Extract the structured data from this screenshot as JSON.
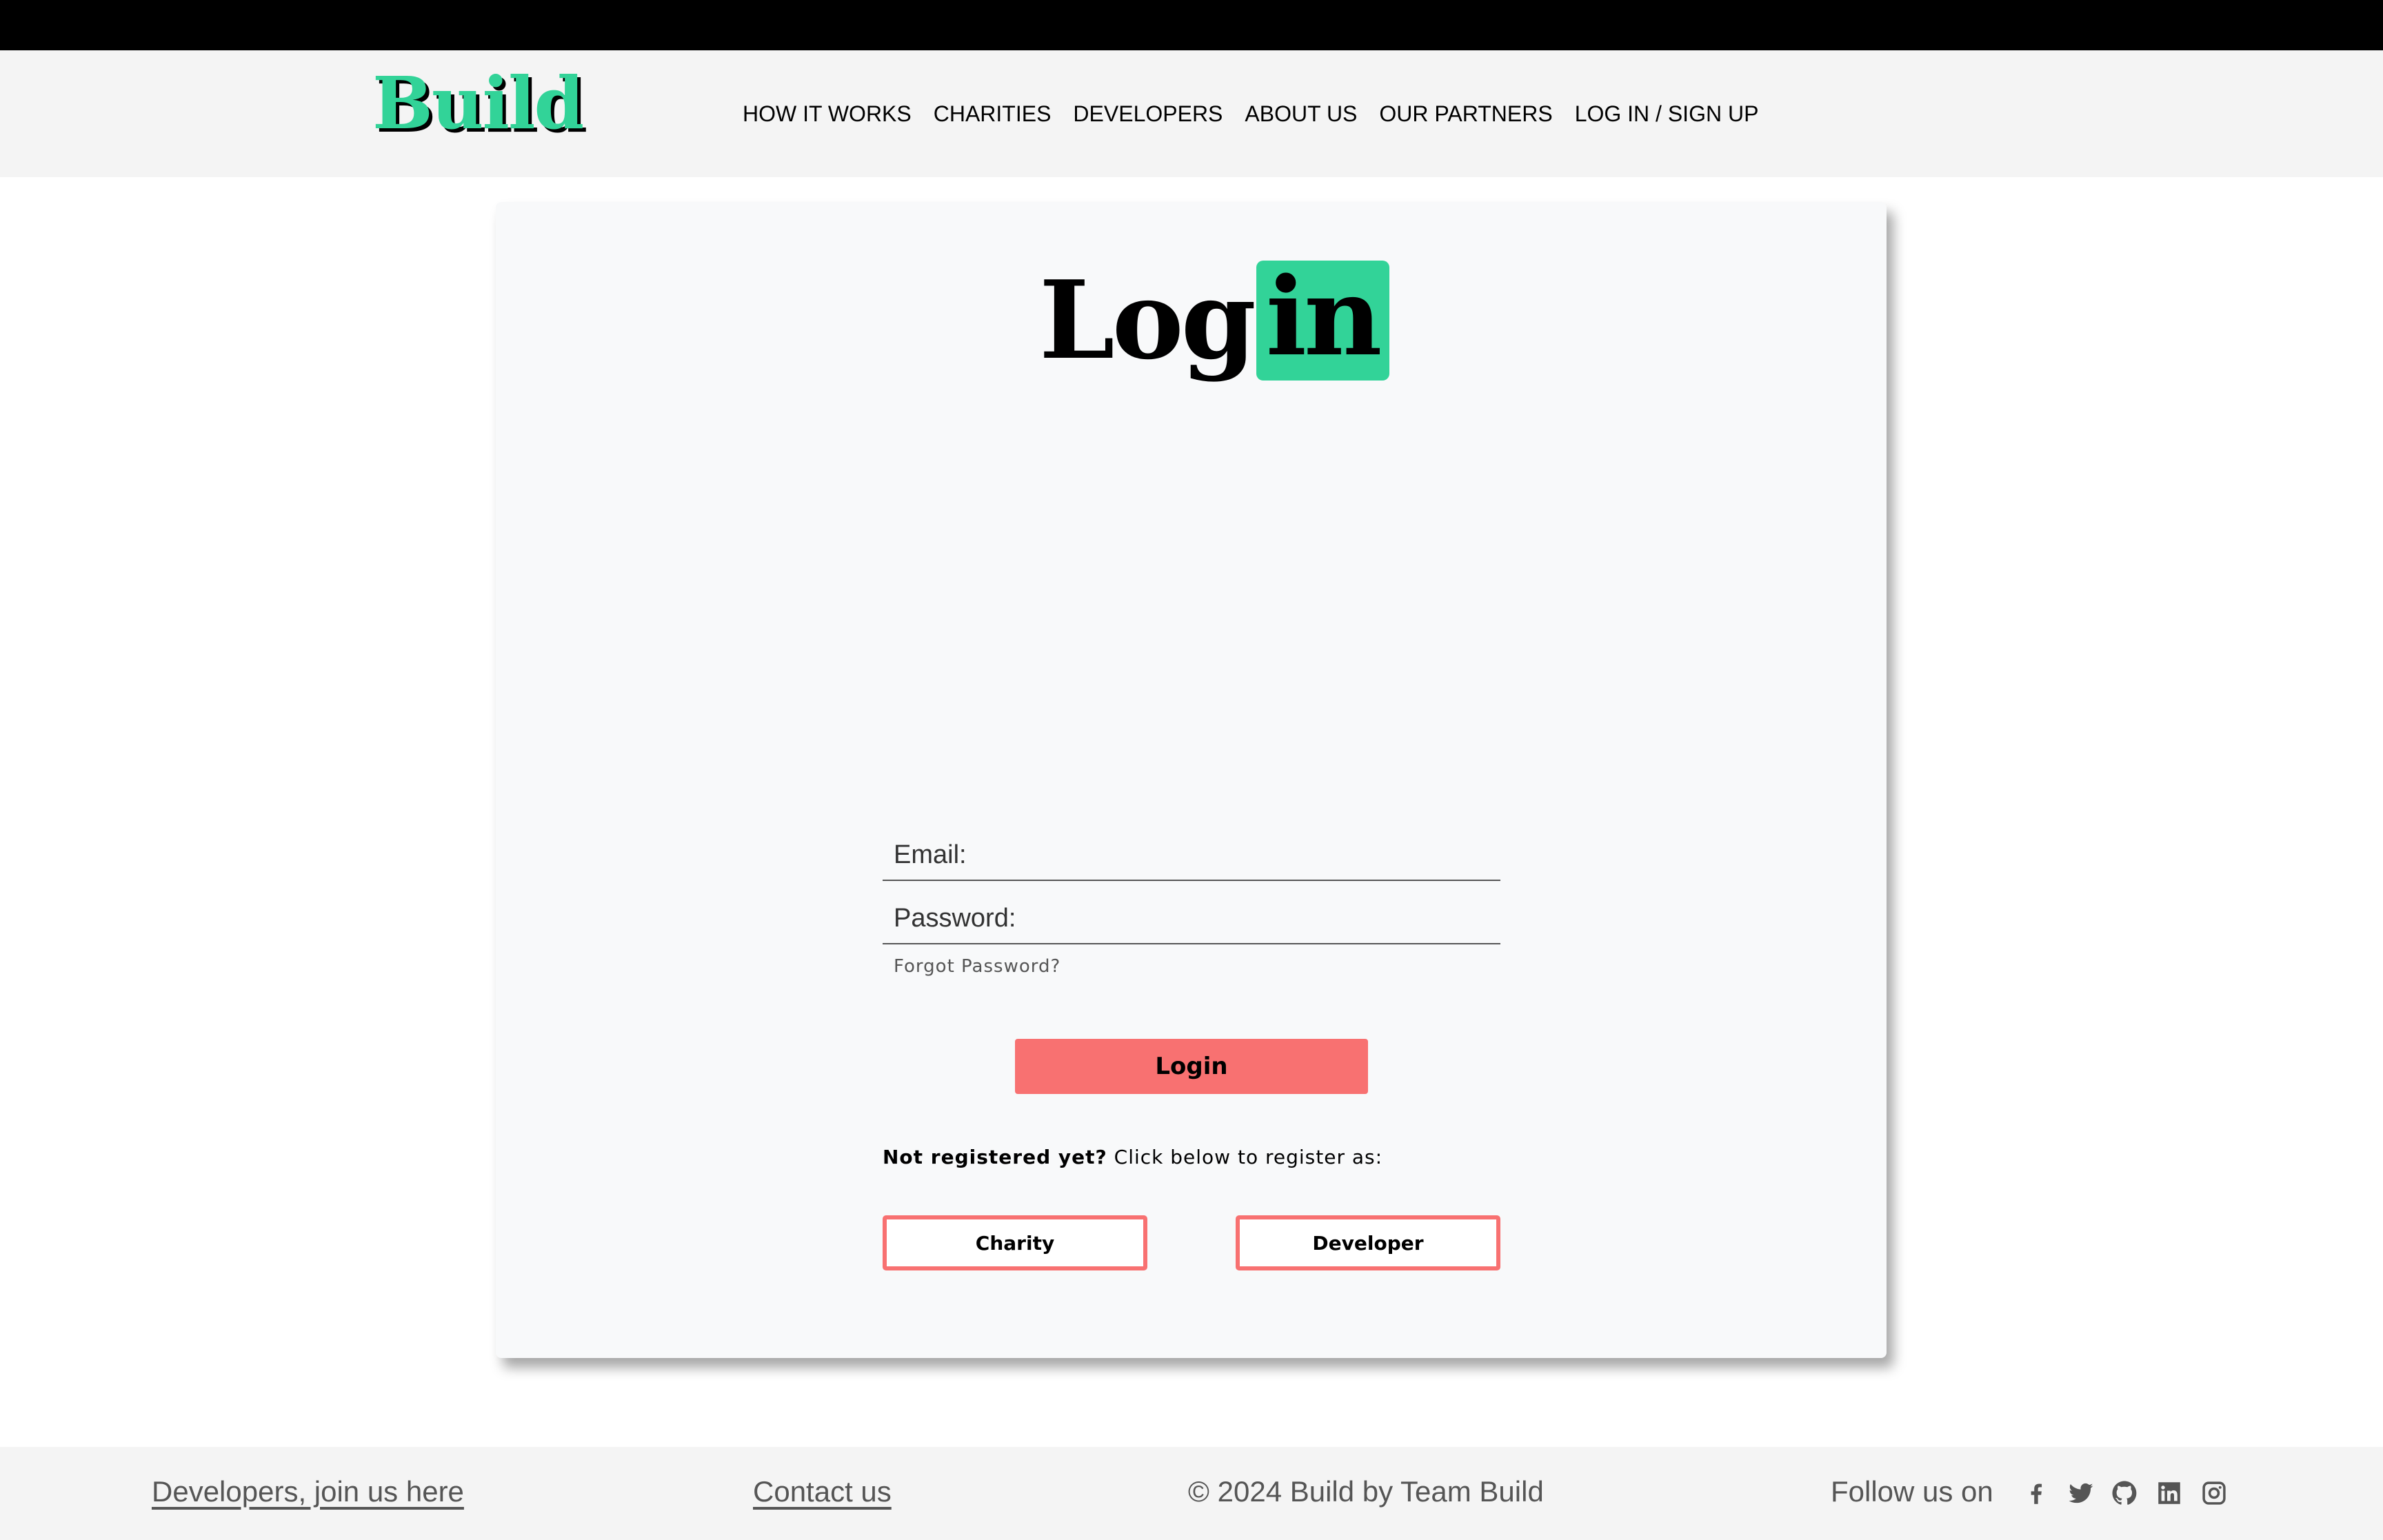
{
  "header": {
    "logo_text": "Build",
    "nav": [
      {
        "label": "HOW IT WORKS"
      },
      {
        "label": "CHARITIES"
      },
      {
        "label": "DEVELOPERS"
      },
      {
        "label": "ABOUT US"
      },
      {
        "label": "OUR PARTNERS"
      },
      {
        "label": "LOG IN / SIGN UP"
      }
    ]
  },
  "login": {
    "title_part1": "Log",
    "title_part2": "in",
    "email_placeholder": "Email:",
    "password_placeholder": "Password:",
    "forgot_password": "Forgot Password?",
    "login_button": "Login",
    "not_registered_bold": "Not registered yet?",
    "not_registered_rest": " Click below to register as:",
    "charity_button": "Charity",
    "developer_button": "Developer"
  },
  "footer": {
    "developers_link": "Developers, join us here",
    "contact_link": "Contact us",
    "copyright": "© 2024 Build by Team Build",
    "follow_text": "Follow us on",
    "social_icons": [
      "facebook-icon",
      "twitter-icon",
      "github-icon",
      "linkedin-icon",
      "instagram-icon"
    ]
  },
  "colors": {
    "brand_green": "#32d398",
    "accent_red": "#f87171",
    "header_bg": "#f4f4f4",
    "card_bg": "#f8f9fa"
  }
}
